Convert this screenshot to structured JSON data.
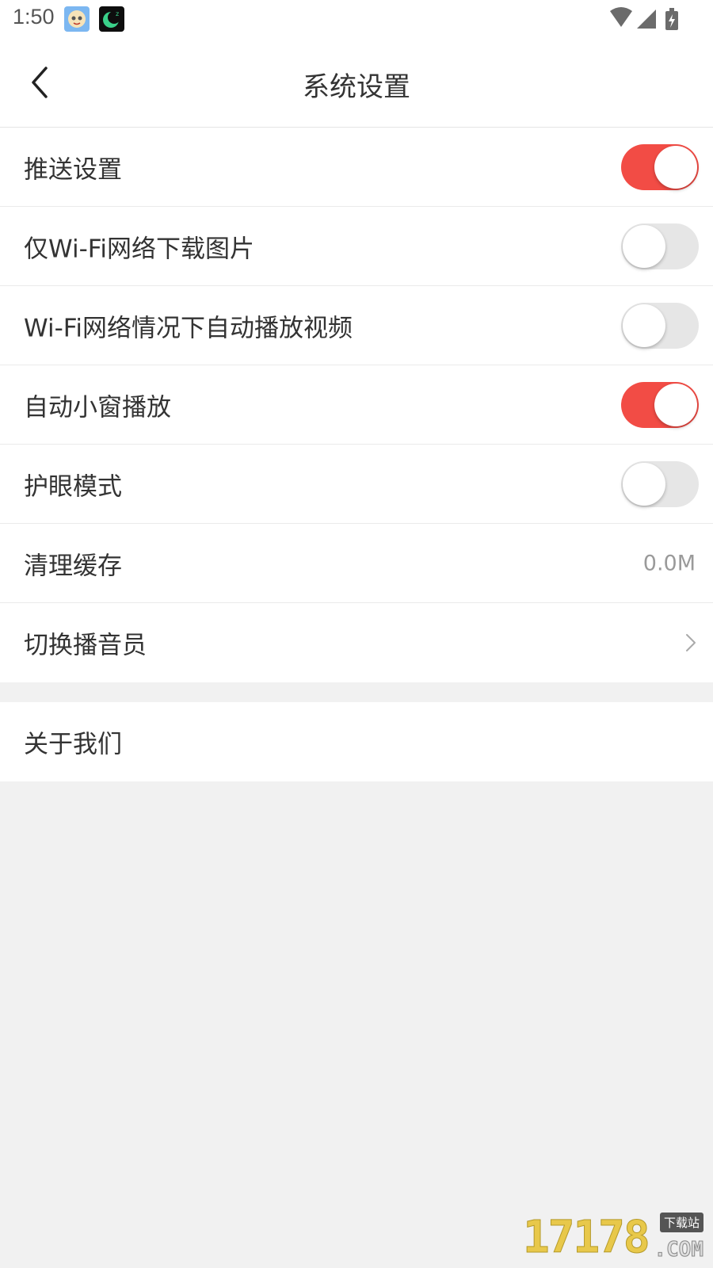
{
  "status_bar": {
    "time": "1:50",
    "icons": [
      "baby-app-icon",
      "moon-app-icon",
      "wifi-icon",
      "signal-icon",
      "battery-charging-icon"
    ]
  },
  "header": {
    "title": "系统设置",
    "back_icon": "back-arrow-icon"
  },
  "settings": {
    "push": {
      "label": "推送设置",
      "enabled": true
    },
    "wifi_images": {
      "label": "仅Wi-Fi网络下载图片",
      "enabled": false
    },
    "wifi_autoplay": {
      "label": "Wi-Fi网络情况下自动播放视频",
      "enabled": false
    },
    "mini_window": {
      "label": "自动小窗播放",
      "enabled": true
    },
    "eye_care": {
      "label": "护眼模式",
      "enabled": false
    },
    "clear_cache": {
      "label": "清理缓存",
      "value": "0.0M"
    },
    "switch_announcer": {
      "label": "切换播音员",
      "icon": "chevron-right-icon"
    }
  },
  "about": {
    "label": "关于我们"
  },
  "watermark": {
    "digits": "17178",
    "badge": "下载站",
    "suffix": ".COM"
  },
  "colors": {
    "toggle_on": "#f24c45",
    "toggle_off": "#e6e6e6",
    "background": "#f1f1f1"
  }
}
